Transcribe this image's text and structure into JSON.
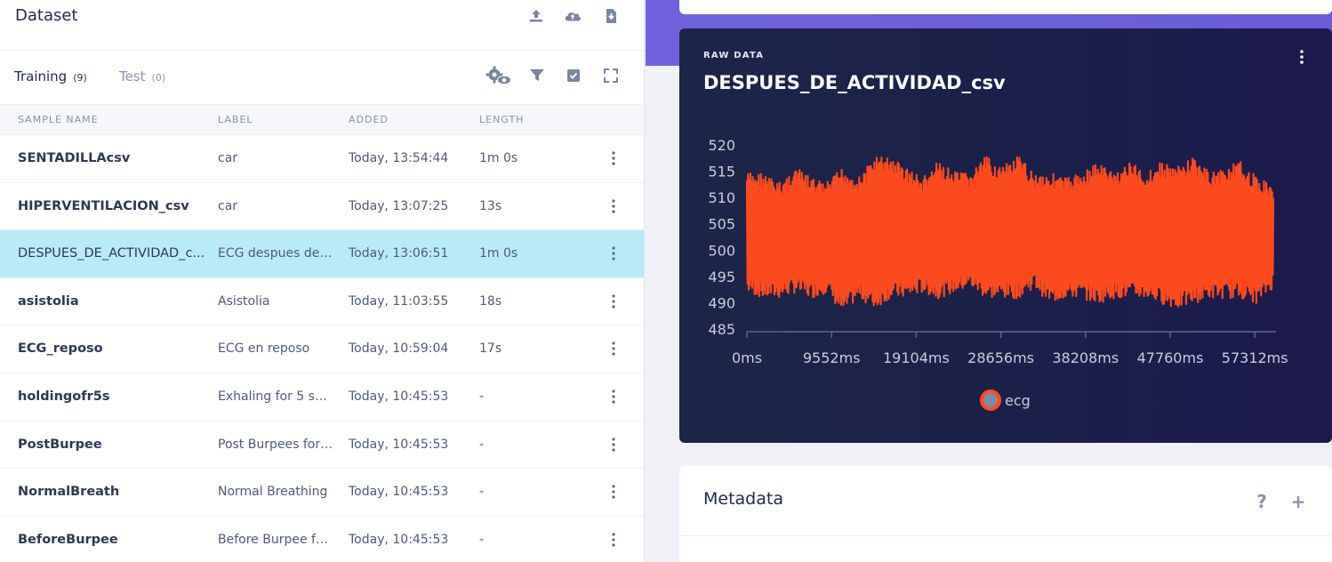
{
  "dataset": {
    "title": "Dataset",
    "icons": [
      "upload-icon",
      "cloud-upload-icon",
      "download-file-icon"
    ]
  },
  "tabs": [
    {
      "label": "Training",
      "count": "(9)",
      "active": true
    },
    {
      "label": "Test",
      "count": "(0)",
      "active": false
    }
  ],
  "toolbar_icons": [
    "settings-eye-icon",
    "filter-icon",
    "checkbox-icon",
    "fullscreen-icon"
  ],
  "columns": {
    "name": "SAMPLE NAME",
    "label": "LABEL",
    "added": "ADDED",
    "length": "LENGTH"
  },
  "samples": [
    {
      "name": "SENTADILLAcsv",
      "label": "car",
      "added": "Today, 13:54:44",
      "length": "1m 0s",
      "selected": false
    },
    {
      "name": "HIPERVENTILACION_csv",
      "label": "car",
      "added": "Today, 13:07:25",
      "length": "13s",
      "selected": false
    },
    {
      "name": "DESPUES_DE_ACTIVIDAD_c...",
      "label": "ECG despues de ...",
      "added": "Today, 13:06:51",
      "length": "1m 0s",
      "selected": true
    },
    {
      "name": "asistolia",
      "label": "Asistolia",
      "added": "Today, 11:03:55",
      "length": "18s",
      "selected": false
    },
    {
      "name": "ECG_reposo",
      "label": "ECG en reposo",
      "added": "Today, 10:59:04",
      "length": "17s",
      "selected": false
    },
    {
      "name": "holdingofr5s",
      "label": "Exhaling for 5 sec...",
      "added": "Today, 10:45:53",
      "length": "-",
      "selected": false
    },
    {
      "name": "PostBurpee",
      "label": "Post Burpees for ...",
      "added": "Today, 10:45:53",
      "length": "-",
      "selected": false
    },
    {
      "name": "NormalBreath",
      "label": "Normal Breathing",
      "added": "Today, 10:45:53",
      "length": "-",
      "selected": false
    },
    {
      "name": "BeforeBurpee",
      "label": "Before Burpee fo...",
      "added": "Today, 10:45:53",
      "length": "-",
      "selected": false
    }
  ],
  "raw": {
    "kicker": "RAW DATA",
    "title": "DESPUES_DE_ACTIVIDAD_csv"
  },
  "chart_data": {
    "type": "line",
    "title": "",
    "xlabel": "",
    "ylabel": "",
    "x_ticks": [
      "0ms",
      "9552ms",
      "19104ms",
      "28656ms",
      "38208ms",
      "47760ms",
      "57312ms"
    ],
    "x_tick_values": [
      0,
      9552,
      19104,
      28656,
      38208,
      47760,
      57312
    ],
    "y_ticks": [
      520,
      515,
      510,
      505,
      500,
      495,
      490,
      485
    ],
    "ylim": [
      485,
      520
    ],
    "xlim": [
      0,
      59700
    ],
    "grid": false,
    "legend_position": "bottom",
    "series": [
      {
        "name": "ecg",
        "color": "#fc4a1f",
        "envelope_x": [
          0,
          1800,
          3600,
          5400,
          7200,
          9000,
          10800,
          12600,
          14400,
          16200,
          18000,
          19800,
          21600,
          23400,
          25200,
          27000,
          28800,
          30600,
          32400,
          34200,
          36000,
          37800,
          39600,
          41400,
          43200,
          45000,
          46800,
          48600,
          50400,
          52200,
          54000,
          55800,
          57600,
          59400
        ],
        "envelope_max": [
          515,
          515,
          513,
          516,
          514,
          513,
          516,
          514,
          518,
          518,
          516,
          514,
          517,
          515,
          515,
          518,
          516,
          518,
          515,
          515,
          514,
          515,
          517,
          515,
          517,
          515,
          517,
          516,
          518,
          515,
          516,
          517,
          514,
          513
        ],
        "envelope_min": [
          492,
          491,
          491,
          492,
          491,
          492,
          488,
          491,
          489,
          491,
          491,
          492,
          491,
          492,
          493,
          491,
          491,
          491,
          493,
          490,
          491,
          491,
          490,
          491,
          491,
          491,
          490,
          489,
          490,
          491,
          491,
          491,
          490,
          493
        ]
      }
    ]
  },
  "legend": {
    "label": "ecg",
    "dot_fill": "#7f8aa3",
    "dot_stroke": "#fc4a1f"
  },
  "metadata": {
    "title": "Metadata",
    "help_label": "?",
    "add_label": "+"
  },
  "colors": {
    "accent": "#6f62dc",
    "selected_row": "#b9ebf7",
    "card_dark": "#1c2547",
    "series": "#fc4a1f"
  }
}
